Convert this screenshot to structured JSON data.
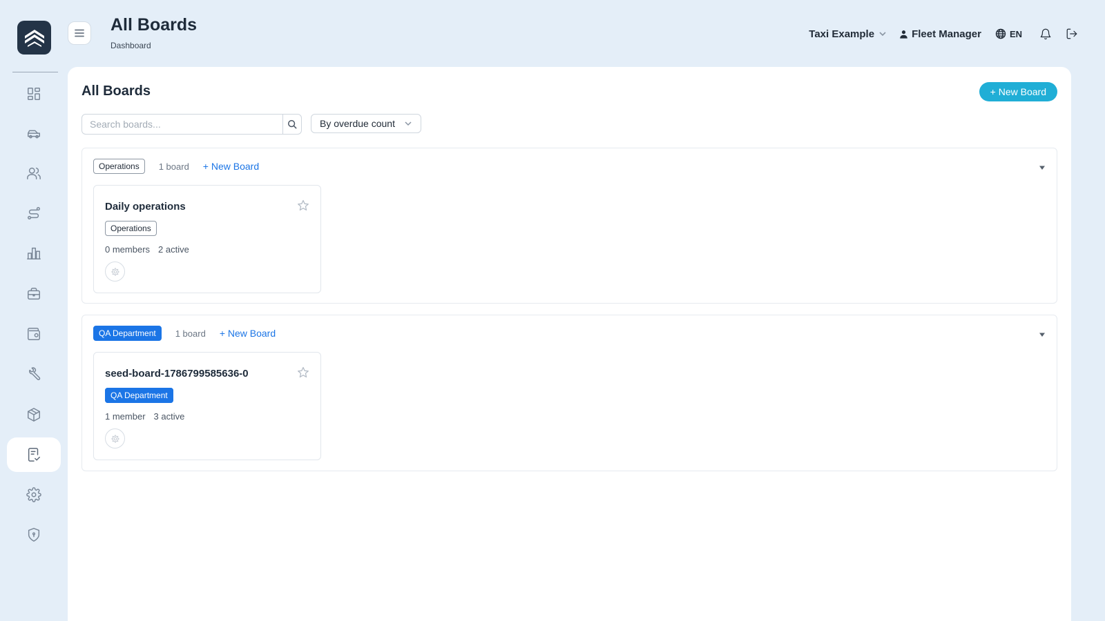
{
  "app": {
    "header_title": "All Boards",
    "breadcrumb": "Dashboard",
    "organization": "Taxi Example",
    "user_role": "Fleet Manager",
    "language": "EN"
  },
  "sidebar": {
    "items": [
      {
        "name": "dashboard",
        "icon": "dashboard-grid-icon",
        "active": false
      },
      {
        "name": "vehicles",
        "icon": "car-icon",
        "active": false
      },
      {
        "name": "drivers",
        "icon": "users-icon",
        "active": false
      },
      {
        "name": "routes",
        "icon": "route-icon",
        "active": false
      },
      {
        "name": "reports",
        "icon": "bar-chart-icon",
        "active": false
      },
      {
        "name": "jobs",
        "icon": "briefcase-icon",
        "active": false
      },
      {
        "name": "wallet",
        "icon": "wallet-icon",
        "active": false
      },
      {
        "name": "maintenance",
        "icon": "wrench-icon",
        "active": false
      },
      {
        "name": "inventory",
        "icon": "box-icon",
        "active": false
      },
      {
        "name": "boards",
        "icon": "clipboard-check-icon",
        "active": true
      },
      {
        "name": "settings",
        "icon": "gear-icon",
        "active": false
      },
      {
        "name": "security",
        "icon": "shield-icon",
        "active": false
      }
    ]
  },
  "main": {
    "title": "All Boards",
    "new_board_label": "+ New Board",
    "search": {
      "placeholder": "Search boards...",
      "value": ""
    },
    "sort": {
      "selected": "By overdue count"
    },
    "groups": [
      {
        "name": "Operations",
        "count_label": "1 board",
        "new_board_label": "+ New Board",
        "tag_color": "outline",
        "boards": [
          {
            "title": "Daily operations",
            "tag": "Operations",
            "members": "0 members",
            "active": "2 active"
          }
        ]
      },
      {
        "name": "QA Department",
        "count_label": "1 board",
        "new_board_label": "+ New Board",
        "tag_color": "#1b75e6",
        "boards": [
          {
            "title": "seed-board-1786799585636-0",
            "tag": "QA Department",
            "members": "1 member",
            "active": "3 active"
          }
        ]
      }
    ]
  },
  "colors": {
    "background": "#e4eef8",
    "accent": "#20aed6",
    "link": "#1b75e6",
    "dark": "#243447"
  }
}
